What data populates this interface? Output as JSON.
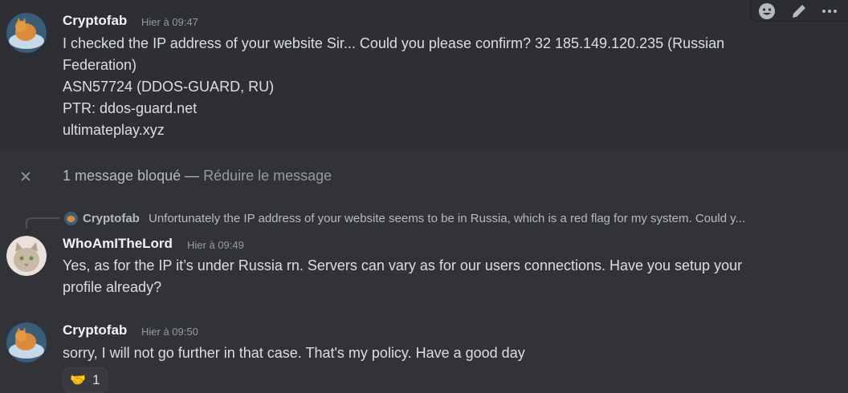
{
  "messages": [
    {
      "username": "Cryptofab",
      "timestamp": "Hier à 09:47",
      "lines": [
        "I checked the IP address of your website Sir... Could you please confirm? 32     185.149.120.235 (Russian",
        "Federation)",
        "ASN57724 (DDOS-GUARD, RU)",
        "PTR: ddos-guard.net",
        "ultimateplay.xyz"
      ]
    },
    {
      "username": "WhoAmITheLord",
      "timestamp": "Hier à 09:49",
      "lines": [
        "Yes, as for the IP it’s under Russia rn. Servers can vary as for our users connections. Have you setup your",
        "profile already?"
      ]
    },
    {
      "username": "Cryptofab",
      "timestamp": "Hier à 09:50",
      "lines": [
        "sorry, I will not go further in that case. That's my policy. Have a good day"
      ]
    }
  ],
  "blocked": {
    "text": "1 message bloqué — ",
    "link": "Réduire le message"
  },
  "reply": {
    "username": "Cryptofab",
    "text": "Unfortunately the IP address of your website seems to be in Russia, which is a red flag for my system. Could y..."
  },
  "reaction": {
    "emoji": "🤝",
    "count": "1"
  },
  "toolbar": {
    "icons": [
      "emoji-icon",
      "edit-icon",
      "more-icon"
    ]
  }
}
